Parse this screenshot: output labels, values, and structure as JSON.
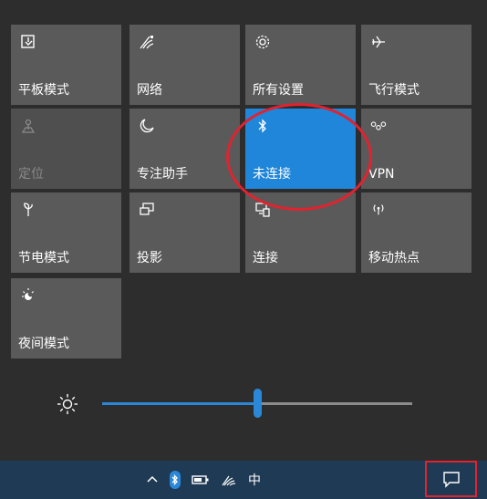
{
  "tiles": [
    {
      "name": "tile-tablet-mode",
      "label": "平板模式",
      "icon": "tablet-mode-icon",
      "state": "normal"
    },
    {
      "name": "tile-network",
      "label": "网络",
      "icon": "wifi-icon",
      "state": "normal"
    },
    {
      "name": "tile-all-settings",
      "label": "所有设置",
      "icon": "gear-icon",
      "state": "normal"
    },
    {
      "name": "tile-airplane-mode",
      "label": "飞行模式",
      "icon": "airplane-icon",
      "state": "normal"
    },
    {
      "name": "tile-location",
      "label": "定位",
      "icon": "location-icon",
      "state": "disabled"
    },
    {
      "name": "tile-focus-assist",
      "label": "专注助手",
      "icon": "moon-icon",
      "state": "normal"
    },
    {
      "name": "tile-bluetooth",
      "label": "未连接",
      "icon": "bluetooth-icon",
      "state": "active"
    },
    {
      "name": "tile-vpn",
      "label": "VPN",
      "icon": "vpn-icon",
      "state": "normal"
    },
    {
      "name": "tile-battery-saver",
      "label": "节电模式",
      "icon": "battery-saver-icon",
      "state": "normal"
    },
    {
      "name": "tile-project",
      "label": "投影",
      "icon": "project-icon",
      "state": "normal"
    },
    {
      "name": "tile-connect",
      "label": "连接",
      "icon": "connect-icon",
      "state": "normal"
    },
    {
      "name": "tile-mobile-hotspot",
      "label": "移动热点",
      "icon": "hotspot-icon",
      "state": "normal"
    },
    {
      "name": "tile-night-light",
      "label": "夜间模式",
      "icon": "night-light-icon",
      "state": "normal"
    }
  ],
  "brightness": {
    "icon": "brightness-icon",
    "level_percent": 50
  },
  "taskbar": {
    "ime_label": "中",
    "tray_icons": [
      "chevron-up-icon",
      "bluetooth-icon",
      "battery-icon",
      "wifi-icon"
    ]
  },
  "colors": {
    "tile_bg": "#5a5a5a",
    "tile_active": "#1f86d9",
    "highlight": "#e0232f",
    "taskbar": "#1f3a54"
  }
}
